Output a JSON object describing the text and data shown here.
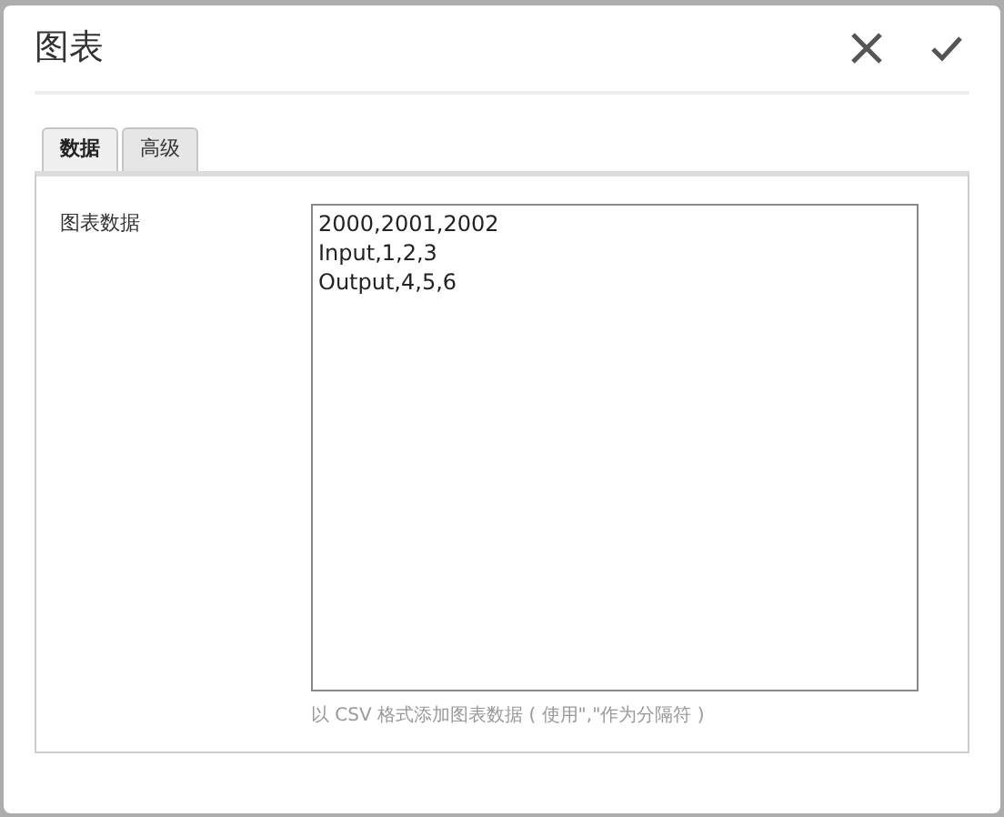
{
  "dialog": {
    "title": "图表"
  },
  "tabs": [
    {
      "label": "数据",
      "selected": true
    },
    {
      "label": "高级",
      "selected": false
    }
  ],
  "field": {
    "label": "图表数据",
    "value": "2000,2001,2002\nInput,1,2,3\nOutput,4,5,6",
    "hint": "以 CSV 格式添加图表数据 ( 使用\",\"作为分隔符 )"
  }
}
